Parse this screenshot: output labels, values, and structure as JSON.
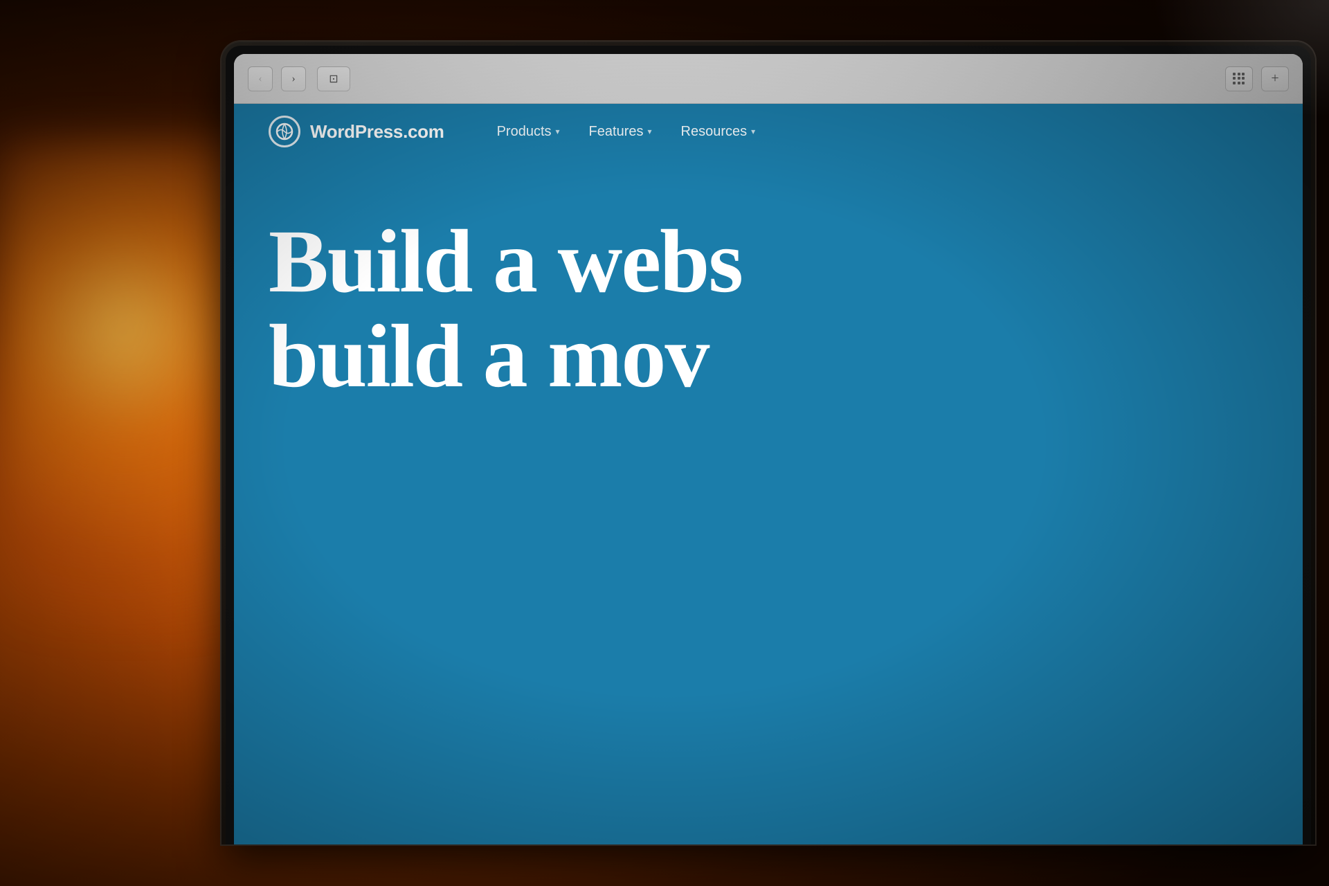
{
  "background": {
    "color": "#1a0a00"
  },
  "browser": {
    "back_button_label": "‹",
    "forward_button_label": "›",
    "sidebar_icon": "⊡",
    "extensions_icon": "grid",
    "new_tab_icon": "+"
  },
  "website": {
    "brand": {
      "logo_letter": "W",
      "name": "WordPress.com"
    },
    "nav": {
      "items": [
        {
          "label": "Products",
          "has_dropdown": true
        },
        {
          "label": "Features",
          "has_dropdown": true
        },
        {
          "label": "Resources",
          "has_dropdown": true
        }
      ]
    },
    "hero": {
      "line1": "Build a webs",
      "line2": "build a mov"
    },
    "background_color": "#1b7daa"
  }
}
